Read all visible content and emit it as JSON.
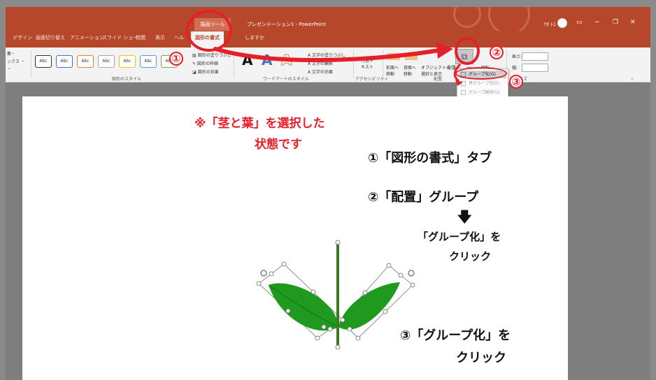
{
  "titlebar": {
    "context_label": "描画ツール",
    "doc_title": "プレゼンテーション1  -  PowerPoint",
    "user_name": "ｹﾀ ﾄｺ",
    "share_label": "共有",
    "minimize": "−",
    "restore": "❐",
    "close": "✕",
    "layout_icon": "▭"
  },
  "tabs": [
    {
      "label": "デザイン"
    },
    {
      "label": "画面切り替え"
    },
    {
      "label": "アニメーション"
    },
    {
      "label": "スライド ショー"
    },
    {
      "label": "校閲"
    },
    {
      "label": "表示"
    },
    {
      "label": "ヘル"
    },
    {
      "label": "図形の書式"
    },
    {
      "label": "しますか"
    }
  ],
  "ribbon": {
    "left_fragments": [
      "集・",
      "ックス ・",
      "・"
    ],
    "style_samples": [
      "Abc",
      "Abc",
      "Abc",
      "Abc",
      "Abc",
      "Abc",
      "Abc"
    ],
    "shape_fill": "図形の塗りつぶし",
    "shape_outline": "図形の枠線",
    "shape_effects": "図形の効果",
    "shape_styles_group": "図形のスタイル",
    "wordart_letters": [
      "A",
      "A",
      "A"
    ],
    "text_fill": "文字の塗りつぶし",
    "text_outline": "文字の輪郭",
    "text_effects": "文字の効果",
    "wordart_group": "ワードアートのスタイル",
    "alt_text": "代替テ\nキスト",
    "accessibility_group": "アクセシビリティ",
    "bring_forward": "前面へ\n移動",
    "send_backward": "背面へ\n移動",
    "selection_pane": "オブジェクトの\n選択と表示",
    "align": "配置",
    "group_button": "グループ化",
    "rotate": "回転",
    "arrange_group": "配置",
    "height_label": "高さ:",
    "width_label": "幅:",
    "size_group": "サイズ"
  },
  "dropdown": {
    "items": [
      {
        "label": "グループ化(G)",
        "state": "highlighted"
      },
      {
        "label": "再グループ化(E)",
        "state": "disabled"
      },
      {
        "label": "グループ解除(U)",
        "state": "disabled"
      }
    ]
  },
  "annotations": {
    "selected_note_line1": "※「茎と葉」を選択した",
    "selected_note_line2": "状態です",
    "step1": "①「図形の書式」タブ",
    "step2": "②「配置」グループ",
    "down_arrow": "🡇",
    "step2_sub_line1": "「グループ化」を",
    "step2_sub_line2": "クリック",
    "step3_line1": "③「グループ化」を",
    "step3_line2": "クリック",
    "circle_num1": "①",
    "circle_num2": "②",
    "circle_num3": "③"
  },
  "colors": {
    "accent": "#b7472a",
    "annotation_red": "#e5202a",
    "leaf_green": "#1f9a1f",
    "stem_green": "#3d7a1e"
  }
}
